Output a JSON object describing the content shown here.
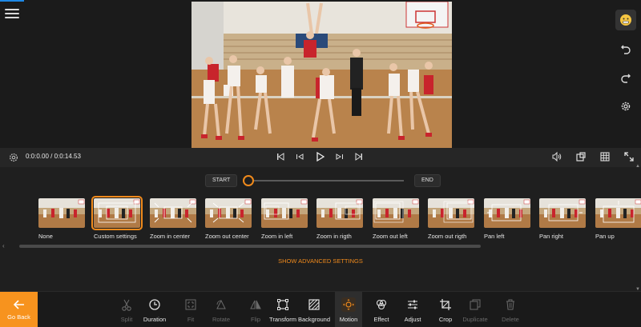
{
  "player": {
    "time": "0:0:0.00 / 0:0:14.53"
  },
  "range": {
    "start_label": "START",
    "end_label": "END",
    "position": 0
  },
  "presets": [
    {
      "label": "None",
      "selected": false
    },
    {
      "label": "Custom settings",
      "selected": true
    },
    {
      "label": "Zoom in center",
      "selected": false
    },
    {
      "label": "Zoom out center",
      "selected": false
    },
    {
      "label": "Zoom in left",
      "selected": false
    },
    {
      "label": "Zoom in rigth",
      "selected": false
    },
    {
      "label": "Zoom out left",
      "selected": false
    },
    {
      "label": "Zoom out rigth",
      "selected": false
    },
    {
      "label": "Pan left",
      "selected": false
    },
    {
      "label": "Pan right",
      "selected": false
    },
    {
      "label": "Pan up",
      "selected": false
    }
  ],
  "advanced_label": "SHOW ADVANCED SETTINGS",
  "toolbar": {
    "go_back": "Go Back",
    "tools": [
      {
        "label": "Split",
        "icon": "scissors-icon",
        "enabled": false
      },
      {
        "label": "Duration",
        "icon": "clock-icon",
        "enabled": true
      },
      {
        "label": "Fit",
        "icon": "fit-icon",
        "enabled": false
      },
      {
        "label": "Rotate",
        "icon": "rotate-icon",
        "enabled": false
      },
      {
        "label": "Flip",
        "icon": "flip-icon",
        "enabled": false
      },
      {
        "label": "Transform",
        "icon": "transform-icon",
        "enabled": true
      },
      {
        "label": "Background",
        "icon": "background-icon",
        "enabled": true
      },
      {
        "label": "Motion",
        "icon": "motion-icon",
        "enabled": true,
        "active": true
      },
      {
        "label": "Effect",
        "icon": "effect-icon",
        "enabled": true
      },
      {
        "label": "Adjust",
        "icon": "adjust-icon",
        "enabled": true
      },
      {
        "label": "Crop",
        "icon": "crop-icon",
        "enabled": true
      },
      {
        "label": "Duplicate",
        "icon": "duplicate-icon",
        "enabled": false
      },
      {
        "label": "Delete",
        "icon": "trash-icon",
        "enabled": false
      }
    ]
  },
  "colors": {
    "accent": "#f08a1c",
    "go_back_bg": "#f7931e"
  }
}
